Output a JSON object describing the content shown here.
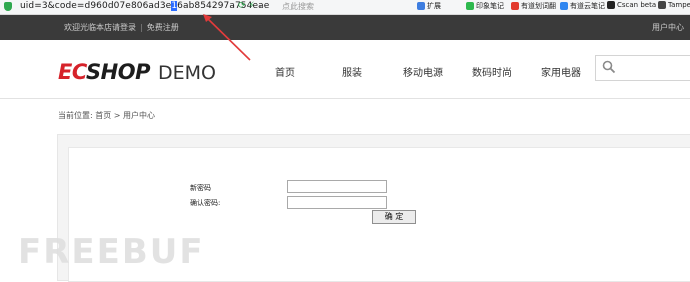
{
  "browser": {
    "url_before": "uid=3&code=d960d07e806ad3e",
    "url_cursor": "1",
    "url_after": "6ab854297a754eae",
    "search_placeholder": "点此搜索",
    "bookmarks": [
      {
        "label": "扩展",
        "color": "#3d7de0"
      },
      {
        "label": "印象笔记",
        "color": "#2db84d"
      },
      {
        "label": "有道划词翻",
        "color": "#e33b2e"
      },
      {
        "label": "有道云笔记",
        "color": "#2f86f0"
      },
      {
        "label": "Cscan beta",
        "color": "#222222"
      },
      {
        "label": "Tampe",
        "color": "#444444"
      }
    ]
  },
  "topbar": {
    "welcome": "欢迎光临本店请登录",
    "register": "免费注册",
    "user_center": "用户中心"
  },
  "header": {
    "logo_ec": "EC",
    "logo_shop": "SHOP",
    "logo_demo": "DEMO",
    "nav": [
      "首页",
      "服装",
      "移动电源",
      "数码时尚",
      "家用电器"
    ]
  },
  "breadcrumb": "当前位置: 首页 > 用户中心",
  "form": {
    "new_password_label": "新密码",
    "confirm_password_label": "确认密码:",
    "submit_label": "确 定"
  },
  "watermark": "FREEBUF",
  "colors": {
    "annotation_arrow": "#e23b3b",
    "topbar": "#3a3a3a"
  }
}
